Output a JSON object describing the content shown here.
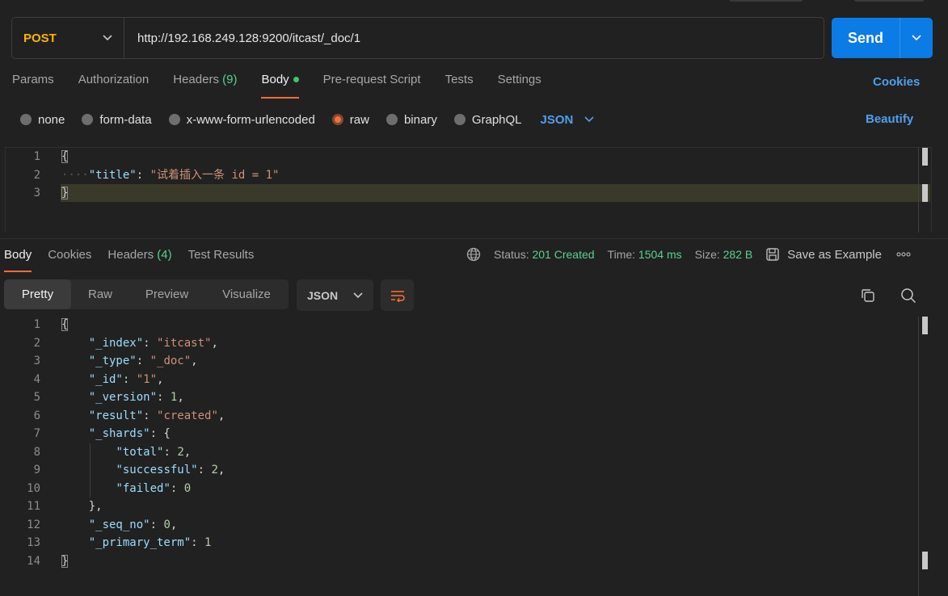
{
  "request": {
    "method": "POST",
    "url": "http://192.168.249.128:9200/itcast/_doc/1",
    "send_label": "Send"
  },
  "request_tabs": {
    "params": "Params",
    "authorization": "Authorization",
    "headers": "Headers",
    "headers_count": "(9)",
    "body": "Body",
    "prerequest": "Pre-request Script",
    "tests": "Tests",
    "settings": "Settings",
    "cookies": "Cookies"
  },
  "body_types": {
    "none": "none",
    "form_data": "form-data",
    "urlencoded": "x-www-form-urlencoded",
    "raw": "raw",
    "binary": "binary",
    "graphql": "GraphQL",
    "format": "JSON",
    "selected": "raw",
    "beautify": "Beautify"
  },
  "request_body": {
    "line_numbers": [
      "1",
      "2",
      "3"
    ],
    "open_brace": "{",
    "key": "\"title\"",
    "colon": ": ",
    "value": "\"试着插入一条 id = 1\"",
    "close_brace": "}"
  },
  "response_tabs": {
    "body": "Body",
    "cookies": "Cookies",
    "headers": "Headers",
    "headers_count": "(4)",
    "test_results": "Test Results"
  },
  "response_status": {
    "status_label": "Status:",
    "status_value": "201 Created",
    "time_label": "Time:",
    "time_value": "1504 ms",
    "size_label": "Size:",
    "size_value": "282 B",
    "save_example": "Save as Example",
    "more": "ooo"
  },
  "response_view": {
    "pretty": "Pretty",
    "raw": "Raw",
    "preview": "Preview",
    "visualize": "Visualize",
    "format": "JSON"
  },
  "response_body": {
    "line_numbers": [
      "1",
      "2",
      "3",
      "4",
      "5",
      "6",
      "7",
      "8",
      "9",
      "10",
      "11",
      "12",
      "13",
      "14"
    ],
    "index_key": "\"_index\"",
    "index_val": "\"itcast\"",
    "type_key": "\"_type\"",
    "type_val": "\"_doc\"",
    "id_key": "\"_id\"",
    "id_val": "\"1\"",
    "version_key": "\"_version\"",
    "version_val": "1",
    "result_key": "\"result\"",
    "result_val": "\"created\"",
    "shards_key": "\"_shards\"",
    "total_key": "\"total\"",
    "total_val": "2",
    "successful_key": "\"successful\"",
    "successful_val": "2",
    "failed_key": "\"failed\"",
    "failed_val": "0",
    "seq_key": "\"_seq_no\"",
    "seq_val": "0",
    "term_key": "\"_primary_term\"",
    "term_val": "1"
  },
  "colors": {
    "accent": "#ff6c37",
    "send": "#0b7be6",
    "link": "#4d9ff0",
    "method": "#ffb400",
    "success": "#5cd08f"
  }
}
